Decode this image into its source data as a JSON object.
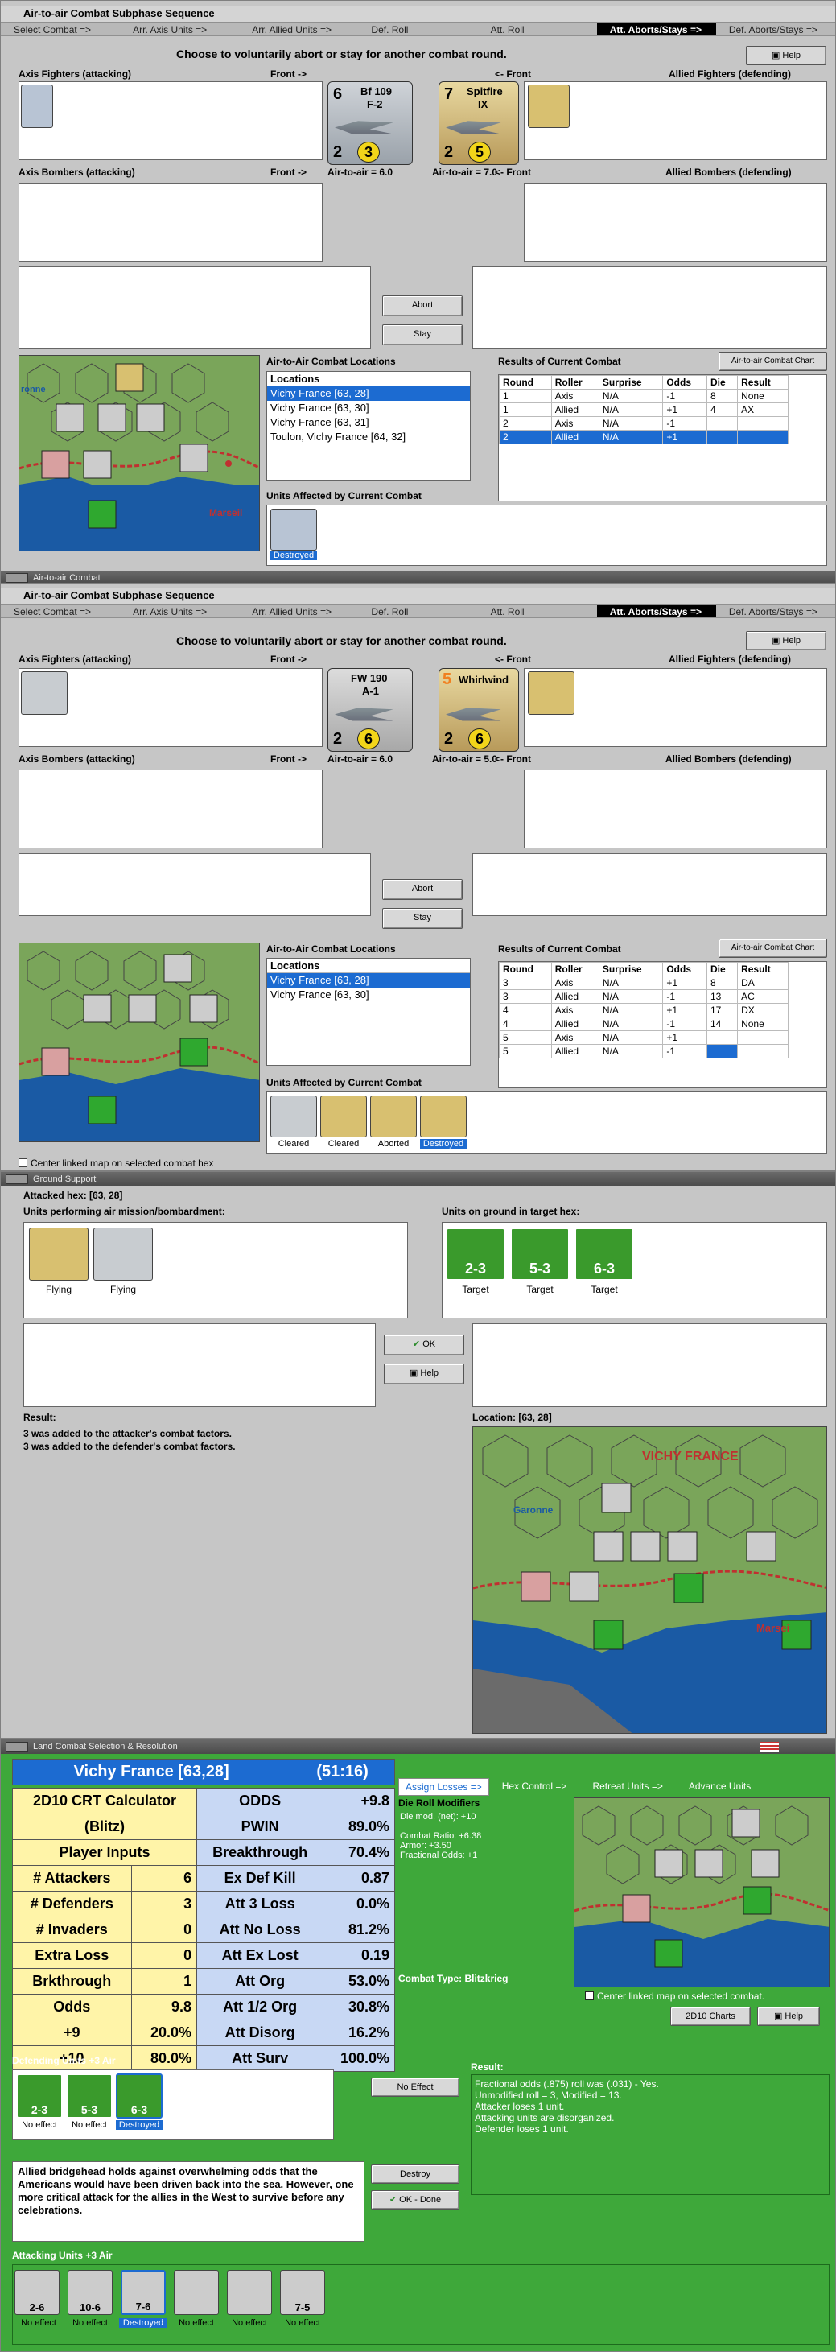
{
  "p1": {
    "window_title": "",
    "subhead": "Air-to-air Combat Subphase Sequence",
    "phases": [
      "Select Combat =>",
      "Arr. Axis Units =>",
      "Arr. Allied Units =>",
      "Def. Roll",
      "Att. Roll",
      "Att. Aborts/Stays =>",
      "Def. Aborts/Stays =>"
    ],
    "active_phase": 5,
    "instruction": "Choose to voluntarily abort or stay for another combat round.",
    "help": "Help",
    "axis_fighters": "Axis Fighters (attacking)",
    "front_right": "Front ->",
    "front_left": "<- Front",
    "allied_fighters": "Allied Fighters (defending)",
    "axis_bombers": "Axis Bombers (attacking)",
    "allied_bombers": "Allied Bombers (defending)",
    "a2a_left": "Air-to-air = 6.0",
    "a2a_right": "Air-to-air = 7.0",
    "big_left": {
      "name": "Bf 109",
      "sub": "F-2",
      "num": "6",
      "att": "2",
      "def": "3"
    },
    "big_right": {
      "name": "Spitfire",
      "sub": "IX",
      "num": "7",
      "att": "2",
      "def": "5"
    },
    "abort": "Abort",
    "stay": "Stay",
    "locations_title": "Air-to-Air Combat Locations",
    "locations_header": "Locations",
    "locations": [
      "Vichy France [63, 28]",
      "Vichy France [63, 30]",
      "Vichy France [63, 31]",
      "Toulon, Vichy France [64, 32]"
    ],
    "results_title": "Results of Current Combat",
    "chart_btn": "Air-to-air Combat Chart",
    "results_head": [
      "Round",
      "Roller",
      "Surprise",
      "Odds",
      "Die",
      "Result"
    ],
    "results": [
      [
        "1",
        "Axis",
        "N/A",
        "-1",
        "8",
        "None"
      ],
      [
        "1",
        "Allied",
        "N/A",
        "+1",
        "4",
        "AX"
      ],
      [
        "2",
        "Axis",
        "N/A",
        "-1",
        "",
        ""
      ],
      [
        "2",
        "Allied",
        "N/A",
        "+1",
        "",
        ""
      ]
    ],
    "affected_title": "Units Affected by Current Combat",
    "affected": [
      {
        "label": "Destroyed"
      }
    ],
    "map_label": "Marseil",
    "map_label2": "ronne"
  },
  "p2": {
    "window_title": "Air-to-air Combat",
    "subhead": "Air-to-air Combat Subphase Sequence",
    "phases": [
      "Select Combat =>",
      "Arr. Axis Units =>",
      "Arr. Allied Units =>",
      "Def. Roll",
      "Att. Roll",
      "Att. Aborts/Stays =>",
      "Def. Aborts/Stays =>"
    ],
    "active_phase": 5,
    "instruction": "Choose to voluntarily abort or stay for another combat round.",
    "help": "Help",
    "axis_fighters": "Axis Fighters (attacking)",
    "front_right": "Front ->",
    "front_left": "<- Front",
    "allied_fighters": "Allied Fighters (defending)",
    "axis_bombers": "Axis Bombers (attacking)",
    "allied_bombers": "Allied Bombers (defending)",
    "a2a_left": "Air-to-air = 6.0",
    "a2a_right": "Air-to-air = 5.0",
    "big_left": {
      "name": "FW 190",
      "sub": "A-1",
      "num": "",
      "att": "2",
      "def": "6"
    },
    "big_right": {
      "name": "Whirlwind",
      "sub": "",
      "num": "5",
      "att": "2",
      "def": "6"
    },
    "abort": "Abort",
    "stay": "Stay",
    "locations_title": "Air-to-Air Combat Locations",
    "locations_header": "Locations",
    "locations": [
      "Vichy France [63, 28]",
      "Vichy France [63, 30]"
    ],
    "results_title": "Results of Current Combat",
    "chart_btn": "Air-to-air Combat Chart",
    "results_head": [
      "Round",
      "Roller",
      "Surprise",
      "Odds",
      "Die",
      "Result"
    ],
    "results": [
      [
        "3",
        "Axis",
        "N/A",
        "+1",
        "8",
        "DA"
      ],
      [
        "3",
        "Allied",
        "N/A",
        "-1",
        "13",
        "AC"
      ],
      [
        "4",
        "Axis",
        "N/A",
        "+1",
        "17",
        "DX"
      ],
      [
        "4",
        "Allied",
        "N/A",
        "-1",
        "14",
        "None"
      ],
      [
        "5",
        "Axis",
        "N/A",
        "+1",
        "",
        ""
      ],
      [
        "5",
        "Allied",
        "N/A",
        "-1",
        "",
        ""
      ]
    ],
    "affected_title": "Units Affected by Current Combat",
    "affected": [
      {
        "label": "Cleared"
      },
      {
        "label": "Cleared"
      },
      {
        "label": "Aborted"
      },
      {
        "label": "Destroyed"
      }
    ],
    "center_linked": "Center linked map on selected combat hex"
  },
  "p3": {
    "window_title": "Ground Support",
    "attacked_hex": "Attacked hex: [63, 28]",
    "units_air": "Units performing air mission/bombardment:",
    "units_ground": "Units on ground in target hex:",
    "air_units": [
      {
        "label": "Flying"
      },
      {
        "label": "Flying"
      }
    ],
    "ground_units": [
      {
        "label": "Target",
        "value": "2-3"
      },
      {
        "label": "Target",
        "value": "5-3"
      },
      {
        "label": "Target",
        "value": "6-3"
      }
    ],
    "ok": "OK",
    "help": "Help",
    "result_title": "Result:",
    "result_lines": [
      "3 was added to the attacker's combat factors.",
      "3 was added to the defender's combat factors."
    ],
    "location": "Location:  [63, 28]",
    "map_label": "VICHY FRANCE",
    "map_label2": "Garonne",
    "map_label3": "Marsei"
  },
  "p4": {
    "window_title": "Land Combat Selection & Resolution",
    "crt_header": [
      "Vichy France [63,28]",
      "(51:16)"
    ],
    "crt_rows": [
      [
        "2D10 CRT Calculator",
        "",
        "ODDS",
        "+9.8"
      ],
      [
        "(Blitz)",
        "",
        "PWIN",
        "89.0%"
      ],
      [
        "Player Inputs",
        "",
        "Breakthrough",
        "70.4%"
      ],
      [
        "# Attackers",
        "6",
        "Ex Def Kill",
        "0.87"
      ],
      [
        "# Defenders",
        "3",
        "Att 3 Loss",
        "0.0%"
      ],
      [
        "# Invaders",
        "0",
        "Att No Loss",
        "81.2%"
      ],
      [
        "Extra Loss",
        "0",
        "Att Ex Lost",
        "0.19"
      ],
      [
        "Brkthrough",
        "1",
        "Att Org",
        "53.0%"
      ],
      [
        "Odds",
        "9.8",
        "Att 1/2 Org",
        "30.8%"
      ],
      [
        "+9",
        "20.0%",
        "Att Disorg",
        "16.2%"
      ],
      [
        "+10",
        "80.0%",
        "Att Surv",
        "100.0%"
      ]
    ],
    "phases": [
      "Assign Losses =>",
      "Hex Control =>",
      "Retreat Units =>",
      "Advance Units"
    ],
    "die_roll_title": "Die Roll Modifiers",
    "die_roll_lines": [
      "Die mod. (net): +10",
      "",
      "Combat Ratio: +6.38",
      "Armor: +3.50",
      "Fractional Odds: +1"
    ],
    "combat_type": "Combat Type:  Blitzkrieg",
    "center_linked": "Center linked map on selected combat.",
    "chart_btn": "2D10 Charts",
    "help": "Help",
    "defending_title": "Defending Units +3 Air",
    "defenders": [
      {
        "label": "No effect",
        "value": "2-3"
      },
      {
        "label": "No effect",
        "value": "5-3"
      },
      {
        "label": "Destroyed",
        "value": "6-3"
      }
    ],
    "no_effect_btn": "No Effect",
    "result_title": "Result:",
    "result_lines": [
      "Fractional odds (.875) roll was (.031)  - Yes.",
      "Unmodified roll = 3, Modified = 13.",
      "Attacker loses 1 unit.",
      "Attacking units are disorganized.",
      "Defender loses 1 unit."
    ],
    "narrative": "Allied bridgehead holds against overwhelming odds that the Americans would have been driven back into the sea. However, one more critical attack for the allies in the West to survive before any celebrations.",
    "destroy": "Destroy",
    "ok_done": "OK - Done",
    "attacking_title": "Attacking Units +3 Air",
    "attackers": [
      {
        "label": "No effect",
        "value": "2-6"
      },
      {
        "label": "No effect",
        "value": "10-6"
      },
      {
        "label": "Destroyed",
        "value": "7-6"
      },
      {
        "label": "No effect",
        "value": ""
      },
      {
        "label": "No effect",
        "value": ""
      },
      {
        "label": "No effect",
        "value": "7-5"
      }
    ]
  }
}
